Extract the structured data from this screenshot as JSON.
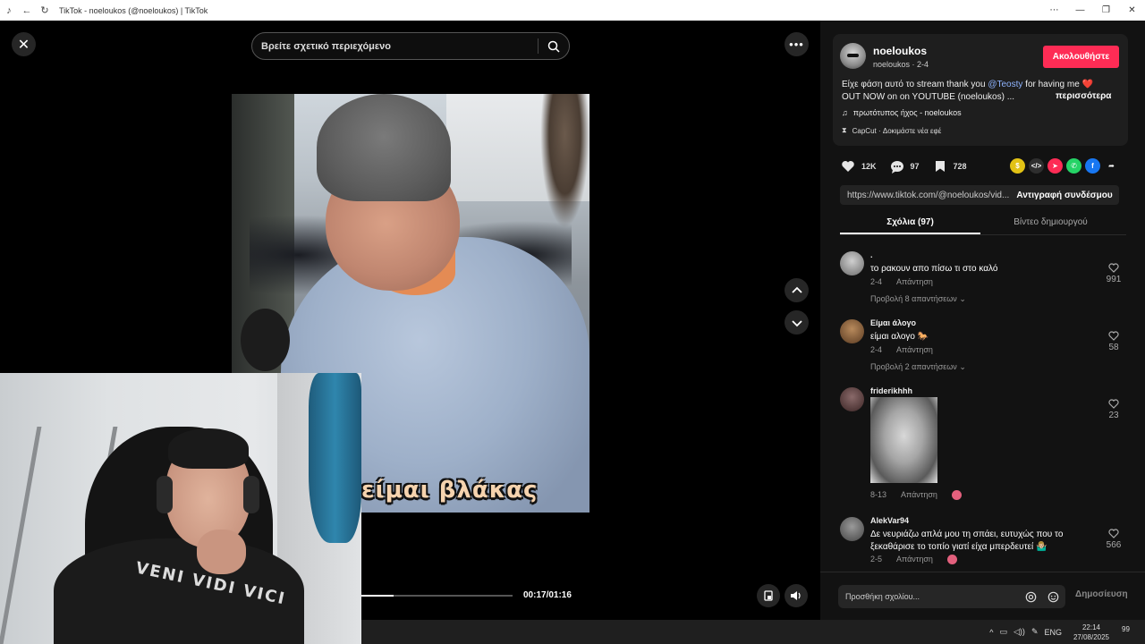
{
  "window": {
    "title": "TikTok - noeloukos (@noeloukos) | TikTok"
  },
  "search": {
    "placeholder": "Βρείτε σχετικό περιεχόμενο"
  },
  "video": {
    "caption": "είμαι βλάκας",
    "time": "00:17/01:16",
    "progress": 0.22
  },
  "webcam": {
    "shirt_text": "VENI VIDI VICI"
  },
  "author": {
    "name": "noeloukos",
    "sub": "noeloukos · 2-4",
    "follow_label": "Ακολουθήστε"
  },
  "description": {
    "line1_before": "Είχε φάση αυτό το stream thank you ",
    "mention": "@Teosty",
    "line1_after": " for having me ",
    "heart": "❤️",
    "line2": "OUT NOW on on YOUTUBE (noeloukos) ...",
    "more_label": "περισσότερα"
  },
  "music": {
    "label": "πρωτότυπος ήχος - noeloukos"
  },
  "capcut": {
    "label": "CapCut · Δοκιμάστε νέα εφέ"
  },
  "stats": {
    "likes": "12K",
    "comments": "97",
    "saves": "728"
  },
  "link": {
    "url": "https://www.tiktok.com/@noeloukos/vid...",
    "copy_label": "Αντιγραφή συνδέσμου"
  },
  "tabs": {
    "comments": "Σχόλια (97)",
    "creator_videos": "Βίντεο δημιουργού"
  },
  "comments": [
    {
      "user": ".",
      "text": "το ρακουν απο πίσω τι στο καλό",
      "date": "2-4",
      "reply": "Απάντηση",
      "replies": "Προβολή 8 απαντήσεων",
      "likes": "991"
    },
    {
      "user": "Είμαι άλογο",
      "text": "είμαι αλογο 🐎",
      "date": "2-4",
      "reply": "Απάντηση",
      "replies": "Προβολή 2 απαντήσεων",
      "likes": "58"
    },
    {
      "user": "friderikhhh",
      "text": "",
      "date": "8-13",
      "reply": "Απάντηση",
      "replies": "",
      "likes": "23"
    },
    {
      "user": "AlekVar94",
      "text": "Δε νευριάζω απλά μου τη σπάει, ευτυχώς που το ξεκαθάρισε το τοπίο γιατί είχα μπερδευτεί 🤷🏼‍♂️",
      "date": "2-5",
      "reply": "Απάντηση",
      "replies": "",
      "likes": "566"
    }
  ],
  "comment_bar": {
    "placeholder": "Προσθήκη σχολίου...",
    "post_label": "Δημοσίευση"
  },
  "taskbar": {
    "lang": "ENG",
    "time": "22:14",
    "date": "27/08/2025",
    "notif_count": "99"
  },
  "colors": {
    "accent": "#fe2c55",
    "panel_bg": "#121212",
    "card_bg": "#1e1e1e"
  }
}
